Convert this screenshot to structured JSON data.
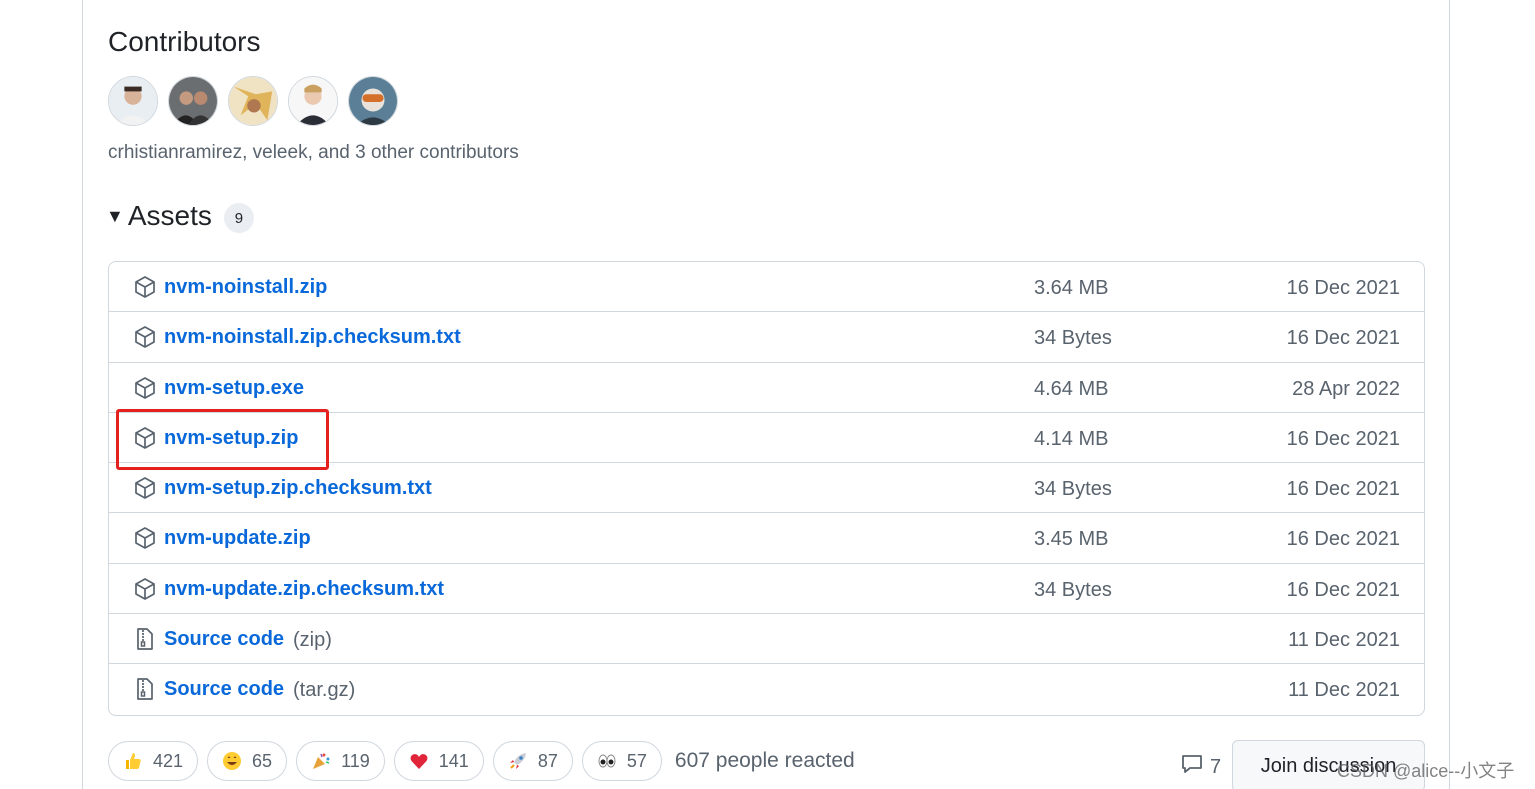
{
  "contributors": {
    "title": "Contributors",
    "text": "crhistianramirez, veleek, and 3 other contributors",
    "avatars": [
      "avatar-1",
      "avatar-2",
      "avatar-3",
      "avatar-4",
      "avatar-5"
    ]
  },
  "assets": {
    "title": "Assets",
    "count": "9",
    "items": [
      {
        "name": "nvm-noinstall.zip",
        "size": "3.64 MB",
        "date": "16 Dec 2021",
        "icon": "package-icon"
      },
      {
        "name": "nvm-noinstall.zip.checksum.txt",
        "size": "34 Bytes",
        "date": "16 Dec 2021",
        "icon": "package-icon"
      },
      {
        "name": "nvm-setup.exe",
        "size": "4.64 MB",
        "date": "28 Apr 2022",
        "icon": "package-icon"
      },
      {
        "name": "nvm-setup.zip",
        "size": "4.14 MB",
        "date": "16 Dec 2021",
        "icon": "package-icon"
      },
      {
        "name": "nvm-setup.zip.checksum.txt",
        "size": "34 Bytes",
        "date": "16 Dec 2021",
        "icon": "package-icon"
      },
      {
        "name": "nvm-update.zip",
        "size": "3.45 MB",
        "date": "16 Dec 2021",
        "icon": "package-icon"
      },
      {
        "name": "nvm-update.zip.checksum.txt",
        "size": "34 Bytes",
        "date": "16 Dec 2021",
        "icon": "package-icon"
      },
      {
        "name": "Source code",
        "ext": "(zip)",
        "size": "",
        "date": "11 Dec 2021",
        "icon": "file-zip-icon"
      },
      {
        "name": "Source code",
        "ext": "(tar.gz)",
        "size": "",
        "date": "11 Dec 2021",
        "icon": "file-zip-icon"
      }
    ]
  },
  "reactions": {
    "items": [
      {
        "emoji": "thumbs-up",
        "count": "421"
      },
      {
        "emoji": "smile",
        "count": "65"
      },
      {
        "emoji": "tada",
        "count": "119"
      },
      {
        "emoji": "heart",
        "count": "141"
      },
      {
        "emoji": "rocket",
        "count": "87"
      },
      {
        "emoji": "eyes",
        "count": "57"
      }
    ],
    "summary": "607 people reacted"
  },
  "discussion": {
    "comment_count": "7",
    "join_label": "Join discussion"
  },
  "watermark": "CSDN @alice--小文子",
  "colors": {
    "link": "#0969da",
    "muted": "#59636e",
    "border": "#d0d7de",
    "highlight": "#e5211d"
  }
}
